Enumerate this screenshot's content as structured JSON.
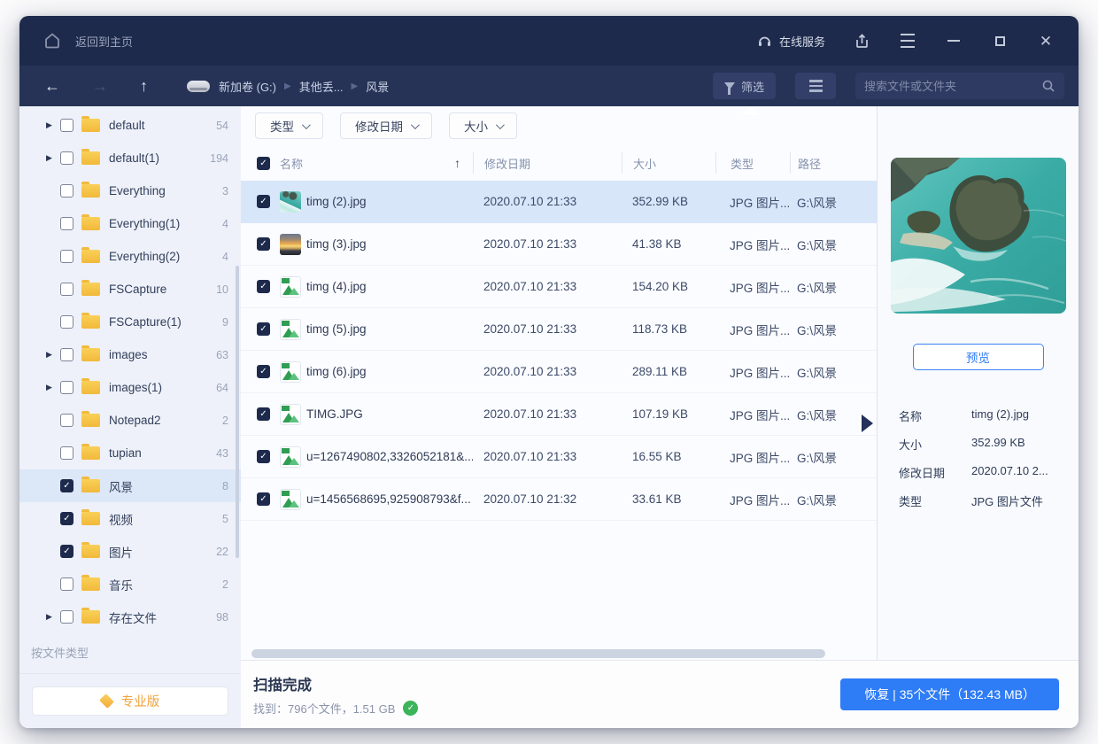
{
  "titlebar": {
    "home_label": "返回到主页",
    "online_service": "在线服务"
  },
  "toolbar": {
    "breadcrumb": [
      "新加卷 (G:)",
      "其他丢...",
      "风景"
    ],
    "filter_label": "筛选",
    "search_placeholder": "搜索文件或文件夹"
  },
  "sidebar": {
    "items": [
      {
        "label": "default",
        "count": "54",
        "expandable": true,
        "checked": false,
        "selected": false
      },
      {
        "label": "default(1)",
        "count": "194",
        "expandable": true,
        "checked": false,
        "selected": false
      },
      {
        "label": "Everything",
        "count": "3",
        "expandable": false,
        "checked": false,
        "selected": false
      },
      {
        "label": "Everything(1)",
        "count": "4",
        "expandable": false,
        "checked": false,
        "selected": false
      },
      {
        "label": "Everything(2)",
        "count": "4",
        "expandable": false,
        "checked": false,
        "selected": false
      },
      {
        "label": "FSCapture",
        "count": "10",
        "expandable": false,
        "checked": false,
        "selected": false
      },
      {
        "label": "FSCapture(1)",
        "count": "9",
        "expandable": false,
        "checked": false,
        "selected": false
      },
      {
        "label": "images",
        "count": "63",
        "expandable": true,
        "checked": false,
        "selected": false
      },
      {
        "label": "images(1)",
        "count": "64",
        "expandable": true,
        "checked": false,
        "selected": false
      },
      {
        "label": "Notepad2",
        "count": "2",
        "expandable": false,
        "checked": false,
        "selected": false
      },
      {
        "label": "tupian",
        "count": "43",
        "expandable": false,
        "checked": false,
        "selected": false
      },
      {
        "label": "风景",
        "count": "8",
        "expandable": false,
        "checked": true,
        "selected": true
      },
      {
        "label": "视频",
        "count": "5",
        "expandable": false,
        "checked": true,
        "selected": false
      },
      {
        "label": "图片",
        "count": "22",
        "expandable": false,
        "checked": true,
        "selected": false
      },
      {
        "label": "音乐",
        "count": "2",
        "expandable": false,
        "checked": false,
        "selected": false
      },
      {
        "label": "存在文件",
        "count": "98",
        "expandable": true,
        "checked": false,
        "selected": false
      }
    ],
    "footer_label": "按文件类型",
    "pro_button": "专业版"
  },
  "filters": {
    "type": "类型",
    "date": "修改日期",
    "size": "大小"
  },
  "table": {
    "headers": {
      "name": "名称",
      "date": "修改日期",
      "size": "大小",
      "type": "类型",
      "path": "路径"
    },
    "rows": [
      {
        "name": "timg (2).jpg",
        "date": "2020.07.10 21:33",
        "size": "352.99 KB",
        "type": "JPG 图片...",
        "path": "G:\\风景",
        "thumb": "photo-teal",
        "checked": true,
        "selected": true
      },
      {
        "name": "timg (3).jpg",
        "date": "2020.07.10 21:33",
        "size": "41.38 KB",
        "type": "JPG 图片...",
        "path": "G:\\风景",
        "thumb": "photo-sunset",
        "checked": true,
        "selected": false
      },
      {
        "name": "timg (4).jpg",
        "date": "2020.07.10 21:33",
        "size": "154.20 KB",
        "type": "JPG 图片...",
        "path": "G:\\风景",
        "thumb": "jpg-icon",
        "checked": true,
        "selected": false
      },
      {
        "name": "timg (5).jpg",
        "date": "2020.07.10 21:33",
        "size": "118.73 KB",
        "type": "JPG 图片...",
        "path": "G:\\风景",
        "thumb": "jpg-icon",
        "checked": true,
        "selected": false
      },
      {
        "name": "timg (6).jpg",
        "date": "2020.07.10 21:33",
        "size": "289.11 KB",
        "type": "JPG 图片...",
        "path": "G:\\风景",
        "thumb": "jpg-icon",
        "checked": true,
        "selected": false
      },
      {
        "name": "TIMG.JPG",
        "date": "2020.07.10 21:33",
        "size": "107.19 KB",
        "type": "JPG 图片...",
        "path": "G:\\风景",
        "thumb": "jpg-icon",
        "checked": true,
        "selected": false
      },
      {
        "name": "u=1267490802,3326052181&...",
        "date": "2020.07.10 21:33",
        "size": "16.55 KB",
        "type": "JPG 图片...",
        "path": "G:\\风景",
        "thumb": "jpg-icon",
        "checked": true,
        "selected": false
      },
      {
        "name": "u=1456568695,925908793&f...",
        "date": "2020.07.10 21:32",
        "size": "33.61 KB",
        "type": "JPG 图片...",
        "path": "G:\\风景",
        "thumb": "jpg-icon",
        "checked": true,
        "selected": false
      }
    ]
  },
  "preview": {
    "button": "预览",
    "details": [
      {
        "label": "名称",
        "value": "timg (2).jpg"
      },
      {
        "label": "大小",
        "value": "352.99 KB"
      },
      {
        "label": "修改日期",
        "value": "2020.07.10 2..."
      },
      {
        "label": "类型",
        "value": "JPG 图片文件"
      }
    ]
  },
  "statusbar": {
    "title": "扫描完成",
    "subtitle": "找到：796个文件，1.51 GB",
    "recover_button": "恢复 | 35个文件（132.43 MB）"
  },
  "colors": {
    "titlebar_navy": "#1d2a4c",
    "toolbar_navy": "#263357",
    "accent_blue": "#2e7cf6",
    "folder_yellow": "#f2bb3e",
    "success_green": "#3cb45a",
    "selected_row": "#d8e6fa"
  }
}
